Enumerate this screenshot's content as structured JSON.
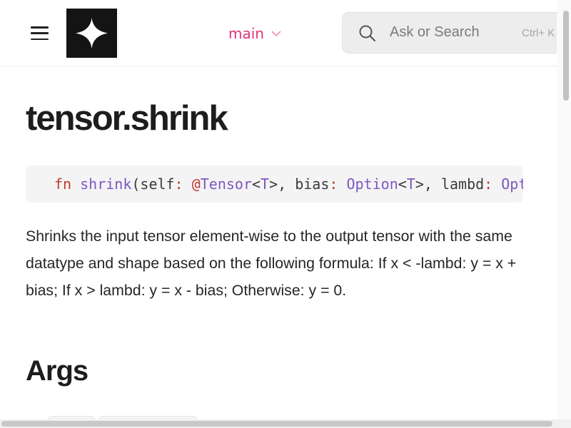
{
  "header": {
    "menu_icon": "hamburger-menu-icon",
    "logo_icon": "four-point-star-logo",
    "branch": {
      "label": "main",
      "chevron_icon": "chevron-down-icon",
      "color": "#e0337a"
    },
    "search": {
      "icon": "search-icon",
      "placeholder": "Ask or Search",
      "shortcut": "Ctrl+ K"
    }
  },
  "page": {
    "title": "tensor.shrink",
    "signature": {
      "kw": "fn",
      "name": "shrink",
      "open": "(self",
      "colon1": ":",
      "at": "@",
      "type1": "Tensor",
      "lt1": "<",
      "t1": "T",
      "gt1": ">, bias",
      "colon2": ":",
      "type2": "Option",
      "lt2": "<",
      "t2": "T",
      "gt2": ">, lambd",
      "colon3": ":",
      "type3": "Opt"
    },
    "description": "Shrinks the input tensor element-wise to the output tensor with the same datatype and shape based on the following formula: If x < -lambd: y = x + bias; If x > lambd: y = x - bias; Otherwise: y = 0.",
    "args_heading": "Args"
  },
  "colors": {
    "accent": "#e0337a",
    "code_keyword": "#c0392b",
    "code_type": "#7d57c1",
    "code_bg": "#f4f4f5"
  }
}
